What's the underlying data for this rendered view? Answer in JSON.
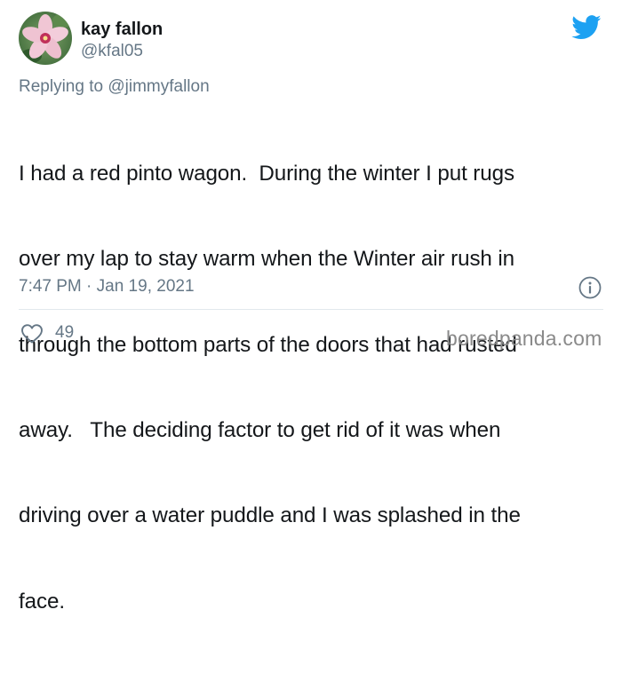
{
  "author": {
    "display_name": "kay fallon",
    "handle": "@kfal05"
  },
  "reply": {
    "prefix": "Replying to",
    "mention": "@jimmyfallon"
  },
  "tweet": {
    "lines": [
      "I had a red pinto wagon.  During the winter I put rugs",
      "over my lap to stay warm when the Winter air rush in",
      "through the bottom parts of the doors that had rusted",
      "away.   The deciding factor to get rid of it was when",
      "driving over a water puddle and I was splashed in the",
      "face."
    ],
    "timestamp": "7:47 PM · Jan 19, 2021"
  },
  "actions": {
    "likes": "49"
  },
  "watermark": "boredpanda.com",
  "icons": {
    "brand": "twitter-bird-icon",
    "info": "info-icon",
    "like": "heart-icon"
  },
  "colors": {
    "twitter_blue": "#1da1f2",
    "text_primary": "#14171a",
    "text_secondary": "#657786",
    "divider": "#e1e8ed"
  }
}
